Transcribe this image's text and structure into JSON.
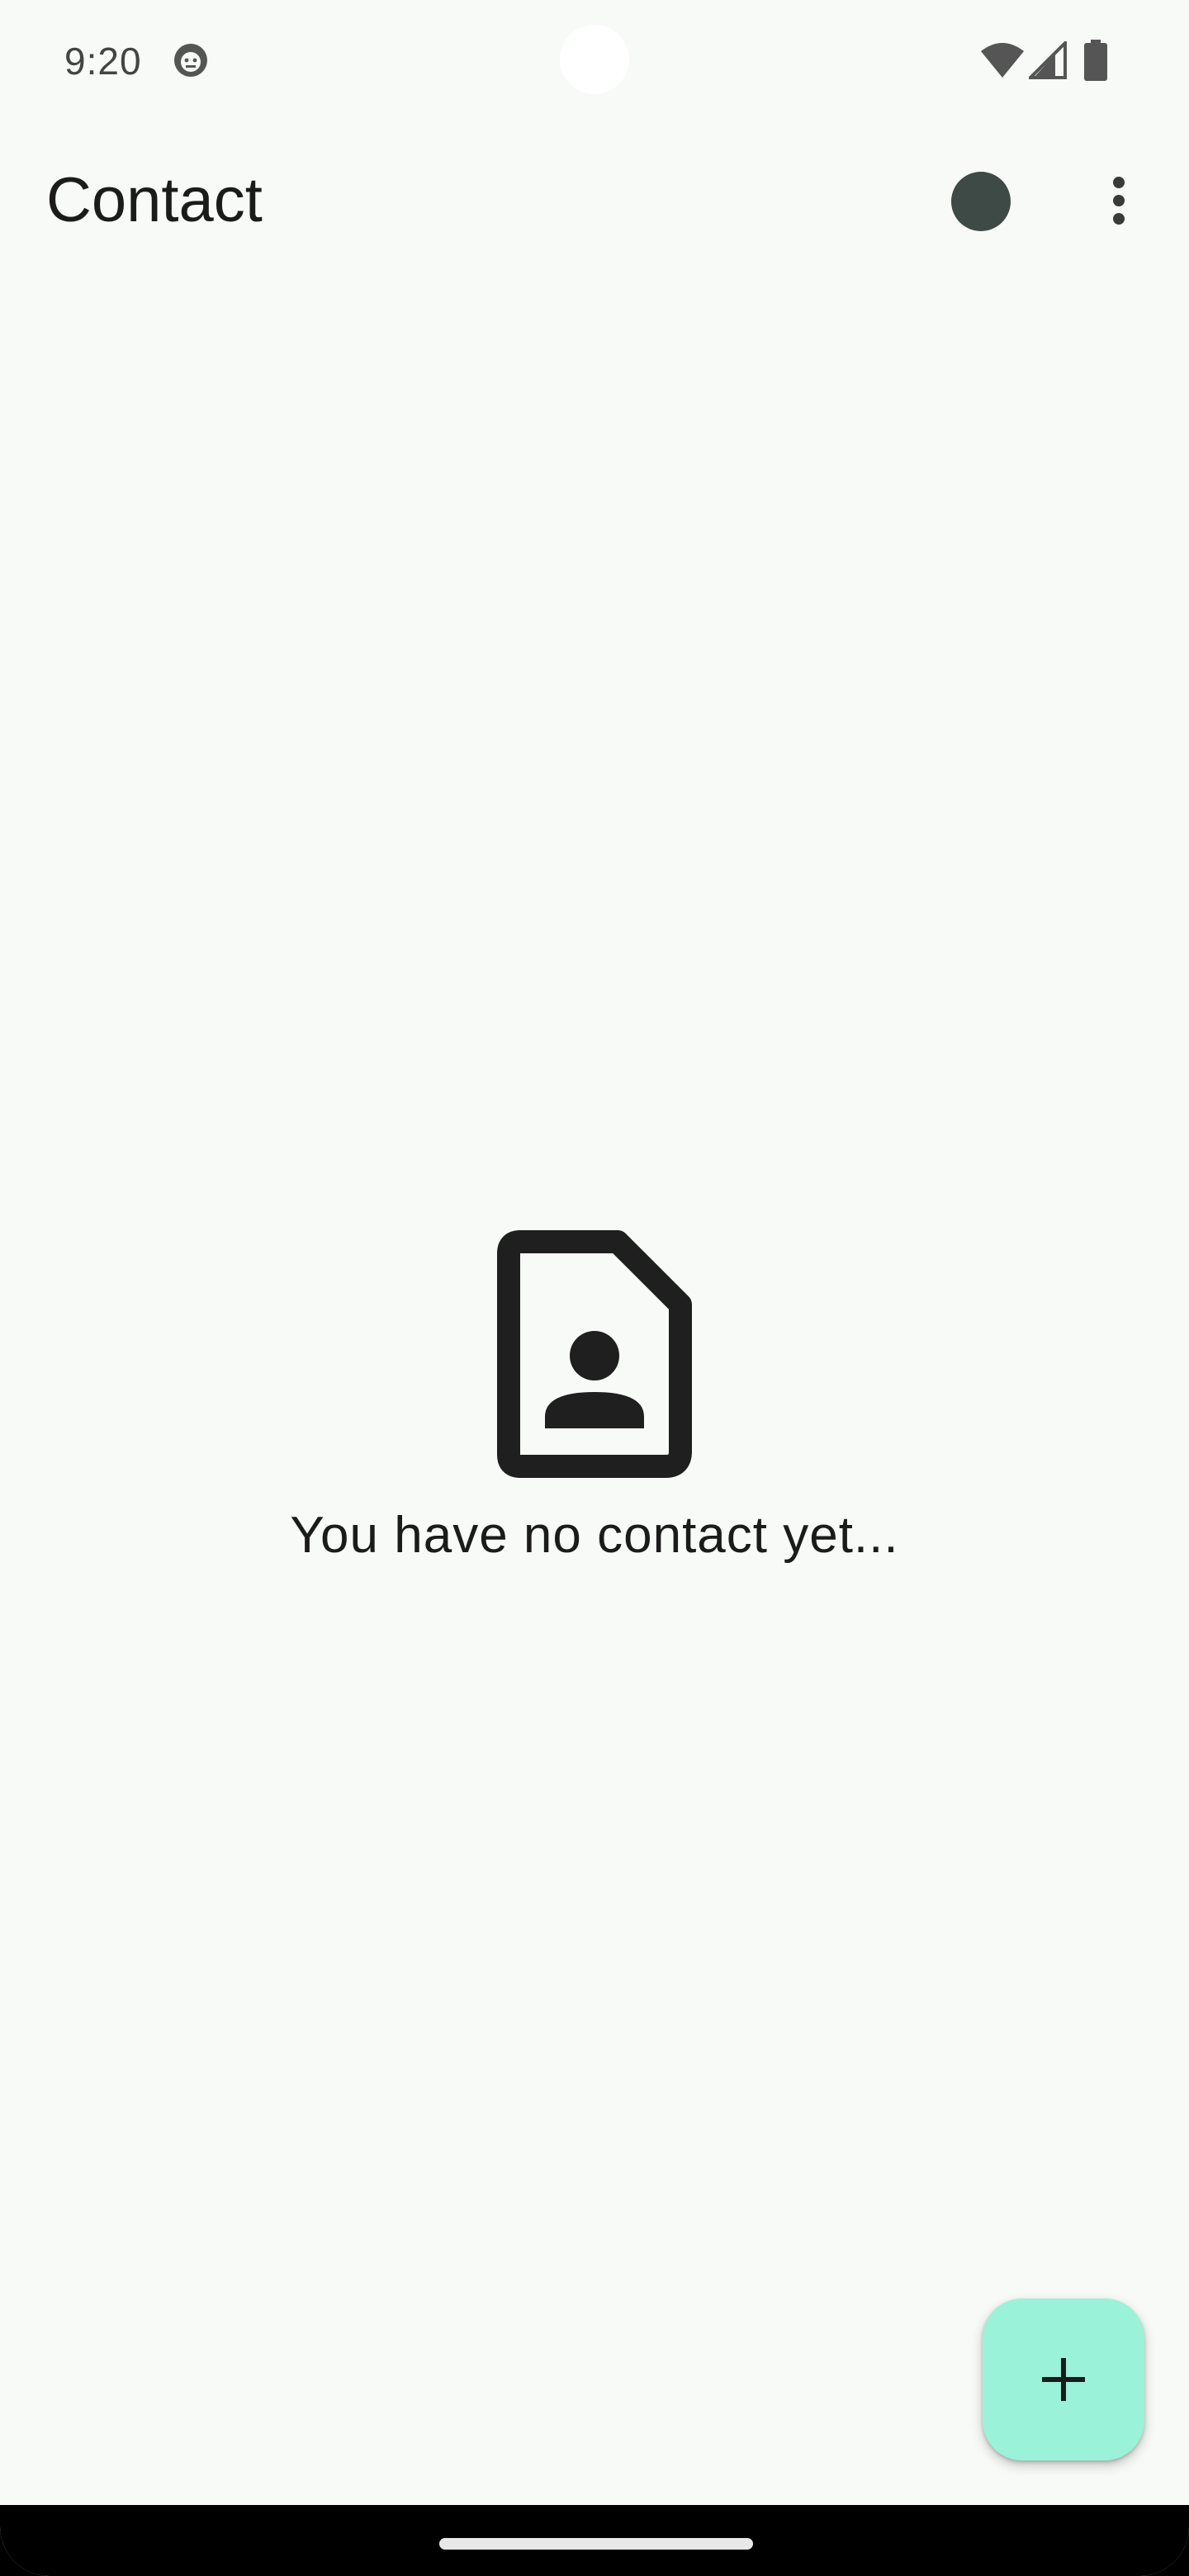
{
  "status_bar": {
    "time": "9:20",
    "app_icon": "android-debug-icon",
    "wifi_icon": "wifi-icon",
    "signal_icon": "cell-signal-icon",
    "battery_icon": "battery-full-icon"
  },
  "app_bar": {
    "title": "Contact",
    "avatar_icon": "avatar-circle",
    "menu_icon": "more-vert-icon"
  },
  "empty_state": {
    "icon": "contact-page-icon",
    "message": "You have no contact yet..."
  },
  "fab": {
    "icon": "plus-icon"
  },
  "colors": {
    "background": "#F8FAF7",
    "avatar": "#3E4A46",
    "fab": "#9AF2D8",
    "text": "#1B1B1B"
  }
}
